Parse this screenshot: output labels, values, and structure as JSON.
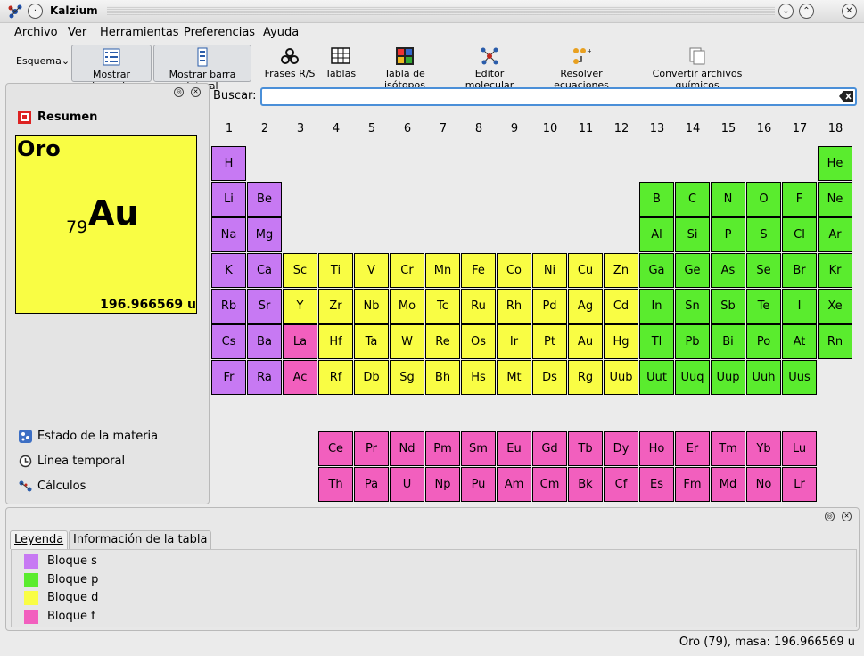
{
  "window": {
    "title": "Kalzium"
  },
  "menu": [
    "Archivo",
    "Ver",
    "Herramientas",
    "Preferencias",
    "Ayuda"
  ],
  "toolbar": {
    "esquema": "Esquema",
    "items": [
      "Mostrar leyenda",
      "Mostrar barra lateral",
      "Frases R/S",
      "Tablas",
      "Tabla de isótopos",
      "Editor molecular",
      "Resolver ecuaciones",
      "Convertir archivos químicos"
    ]
  },
  "sidebar": {
    "summary_title": "Resumen",
    "element": {
      "name": "Oro",
      "number": "79",
      "symbol": "Au",
      "mass": "196.966569 u"
    },
    "tabs": [
      "Estado de la materia",
      "Línea temporal",
      "Cálculos"
    ]
  },
  "search": {
    "label": "Buscar:",
    "value": ""
  },
  "periodic_table": {
    "groups": [
      "1",
      "2",
      "3",
      "4",
      "5",
      "6",
      "7",
      "8",
      "9",
      "10",
      "11",
      "12",
      "13",
      "14",
      "15",
      "16",
      "17",
      "18"
    ],
    "rows": [
      [
        "H",
        "",
        "",
        "",
        "",
        "",
        "",
        "",
        "",
        "",
        "",
        "",
        "",
        "",
        "",
        "",
        "",
        "He"
      ],
      [
        "Li",
        "Be",
        "",
        "",
        "",
        "",
        "",
        "",
        "",
        "",
        "",
        "",
        "B",
        "C",
        "N",
        "O",
        "F",
        "Ne"
      ],
      [
        "Na",
        "Mg",
        "",
        "",
        "",
        "",
        "",
        "",
        "",
        "",
        "",
        "",
        "Al",
        "Si",
        "P",
        "S",
        "Cl",
        "Ar"
      ],
      [
        "K",
        "Ca",
        "Sc",
        "Ti",
        "V",
        "Cr",
        "Mn",
        "Fe",
        "Co",
        "Ni",
        "Cu",
        "Zn",
        "Ga",
        "Ge",
        "As",
        "Se",
        "Br",
        "Kr"
      ],
      [
        "Rb",
        "Sr",
        "Y",
        "Zr",
        "Nb",
        "Mo",
        "Tc",
        "Ru",
        "Rh",
        "Pd",
        "Ag",
        "Cd",
        "In",
        "Sn",
        "Sb",
        "Te",
        "I",
        "Xe"
      ],
      [
        "Cs",
        "Ba",
        "La",
        "Hf",
        "Ta",
        "W",
        "Re",
        "Os",
        "Ir",
        "Pt",
        "Au",
        "Hg",
        "Tl",
        "Pb",
        "Bi",
        "Po",
        "At",
        "Rn"
      ],
      [
        "Fr",
        "Ra",
        "Ac",
        "Rf",
        "Db",
        "Sg",
        "Bh",
        "Hs",
        "Mt",
        "Ds",
        "Rg",
        "Uub",
        "Uut",
        "Uuq",
        "Uup",
        "Uuh",
        "Uus",
        ""
      ]
    ],
    "lanthanides": [
      "Ce",
      "Pr",
      "Nd",
      "Pm",
      "Sm",
      "Eu",
      "Gd",
      "Tb",
      "Dy",
      "Ho",
      "Er",
      "Tm",
      "Yb",
      "Lu"
    ],
    "actinides": [
      "Th",
      "Pa",
      "U",
      "Np",
      "Pu",
      "Am",
      "Cm",
      "Bk",
      "Cf",
      "Es",
      "Fm",
      "Md",
      "No",
      "Lr"
    ],
    "block_colors": {
      "s": "#c779f3",
      "p": "#5aec2e",
      "d": "#f9fd44",
      "f": "#f25fbe"
    }
  },
  "bottom": {
    "tabs": [
      "Leyenda",
      "Información de la tabla"
    ],
    "legend": [
      {
        "label": "Bloque s",
        "color": "#c779f3"
      },
      {
        "label": "Bloque p",
        "color": "#5aec2e"
      },
      {
        "label": "Bloque d",
        "color": "#f9fd44"
      },
      {
        "label": "Bloque f",
        "color": "#f25fbe"
      }
    ]
  },
  "status": "Oro (79), masa: 196.966569 u"
}
